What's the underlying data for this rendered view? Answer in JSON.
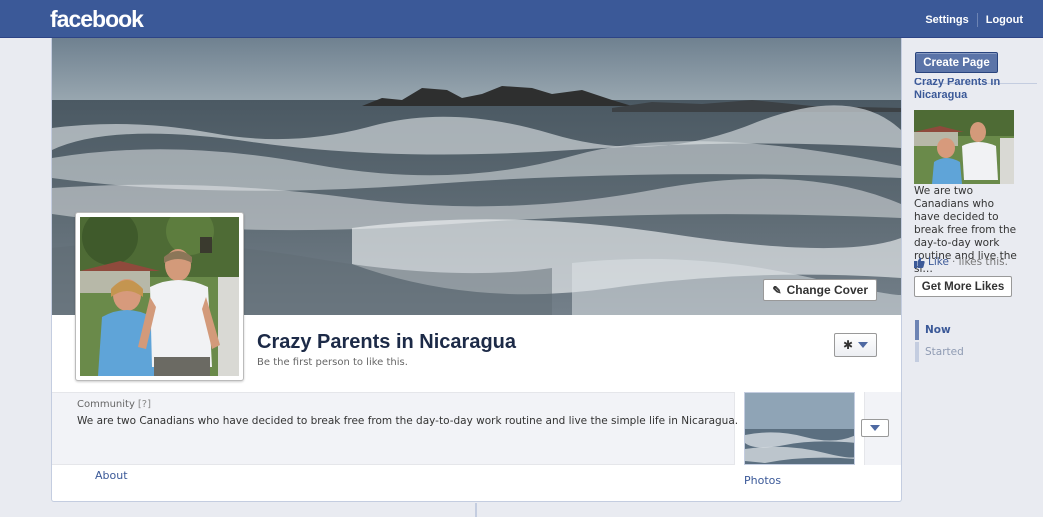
{
  "topbar": {
    "logo": "facebook",
    "settings_label": "Settings",
    "logout_label": "Logout",
    "background": "#3b5998"
  },
  "page": {
    "change_cover_label": "Change Cover",
    "name": "Crazy Parents in Nicaragua",
    "like_prompt": "Be the first person to like this.",
    "category": "Community",
    "category_help": "[?]",
    "description": "We are two Canadians who have decided to break free from the day-to-day work routine and live the simple life in Nicaragua.",
    "about_label": "About",
    "photos_label": "Photos"
  },
  "sidebar": {
    "create_page_label": "Create Page",
    "ad": {
      "title": "Crazy Parents in Nicaragua",
      "text": "We are two Canadians who have decided to break free from the day-to-day work routine and live the si…",
      "like_label": "Like",
      "like_suffix": "· likes this.",
      "get_more_likes_label": "Get More Likes"
    },
    "scrubber": [
      {
        "label": "Now",
        "active": true
      },
      {
        "label": "Started",
        "active": false
      }
    ]
  },
  "colors": {
    "link": "#3b5998",
    "page_bg": "#e9ebf1",
    "button_blue": "#5b74a8"
  },
  "icons": {
    "cover_button_icon": "pencil-icon",
    "page_menu_icon": "gear-icon",
    "like_icon": "thumbs-up-icon"
  }
}
